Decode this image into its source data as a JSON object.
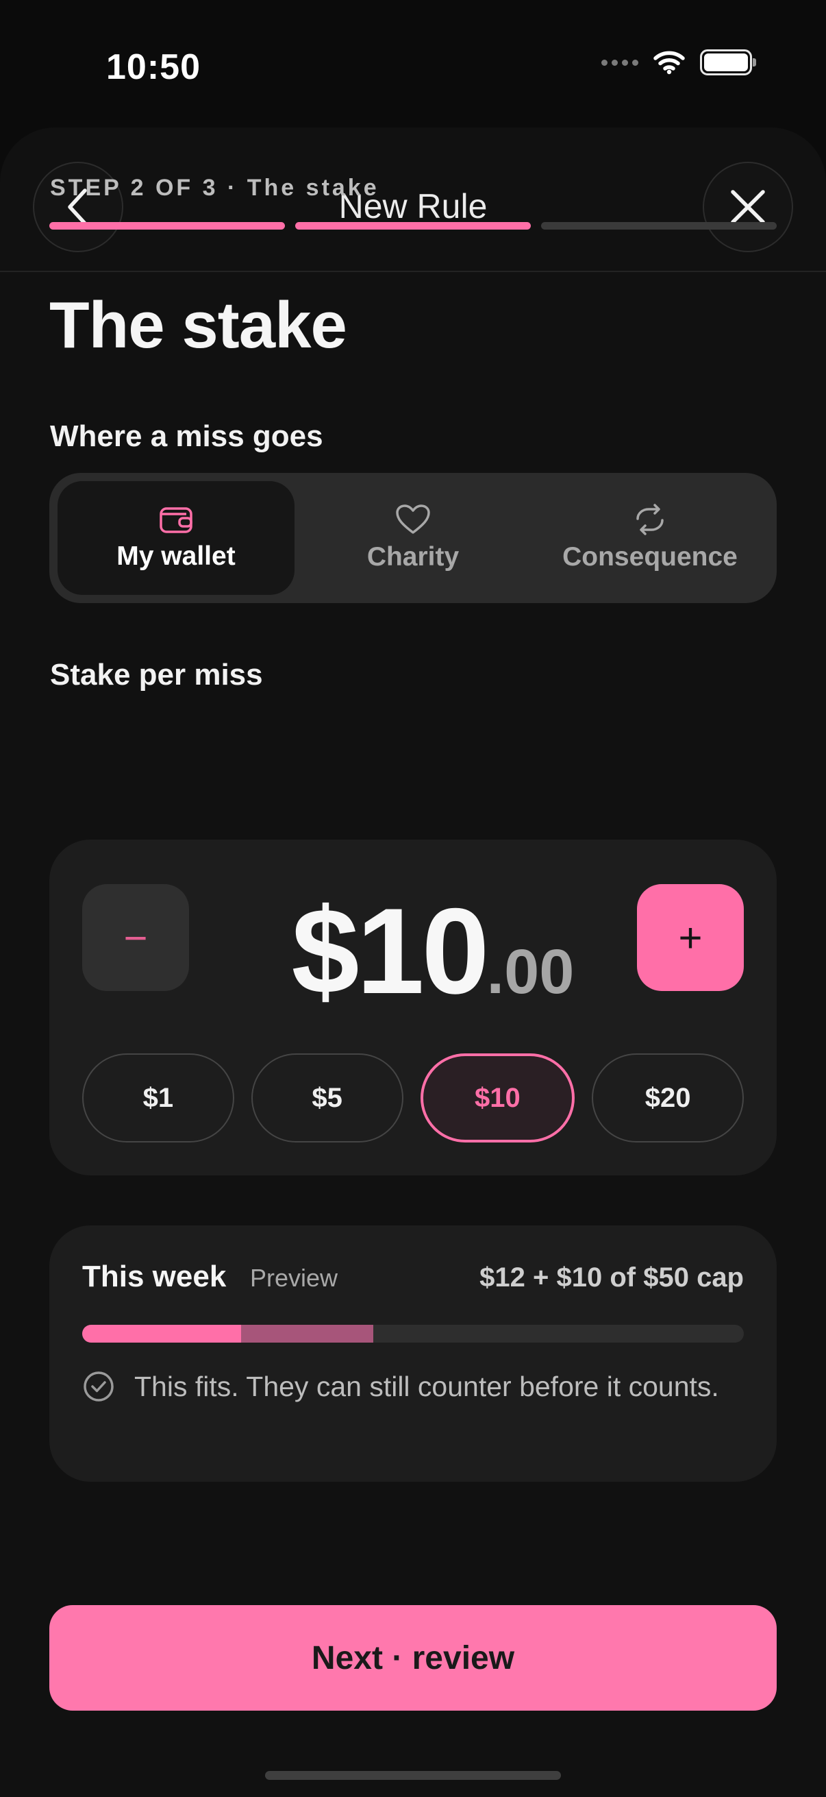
{
  "status_bar": {
    "time": "10:50"
  },
  "nav": {
    "title": "New Rule",
    "back_icon": "chevron-left-icon",
    "close_icon": "close-icon"
  },
  "progress": {
    "label": "STEP 2 OF 3 · The stake",
    "current_step": 2,
    "total_steps": 3
  },
  "page": {
    "title": "The stake"
  },
  "destination": {
    "label": "Where a miss goes",
    "selected": "My wallet",
    "options": [
      {
        "label": "My wallet",
        "icon": "wallet-icon"
      },
      {
        "label": "Charity",
        "icon": "heart-icon"
      },
      {
        "label": "Consequence",
        "icon": "repeat-icon"
      }
    ]
  },
  "stake": {
    "label": "Stake per miss",
    "amount_major": "$10",
    "amount_minor": ".00",
    "decrement_label": "−",
    "increment_label": "+",
    "presets": [
      "$1",
      "$5",
      "$10",
      "$20"
    ],
    "selected_preset": "$10"
  },
  "week": {
    "title": "This week",
    "tag": "Preview",
    "summary": "$12 + $10 of $50 cap",
    "used": 12,
    "adding": 10,
    "cap": 50,
    "note": "This fits. They can still counter before it counts."
  },
  "cta": {
    "label": "Next · review"
  },
  "colors": {
    "accent": "#ff6fa8",
    "background": "#0b0b0b",
    "card": "#1d1d1d"
  }
}
